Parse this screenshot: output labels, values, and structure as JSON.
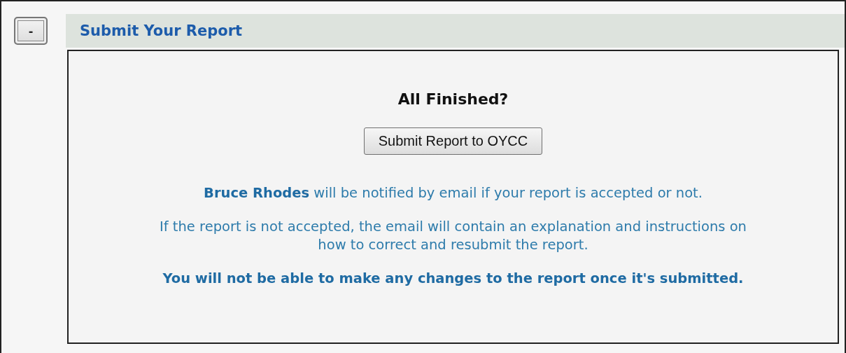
{
  "collapse_button": {
    "label": "-",
    "expanded": true
  },
  "section": {
    "title": "Submit Your Report",
    "heading": "All Finished?",
    "submit_button": "Submit Report to OYCC",
    "notice": "**Bruce Rhodes** will be notified by email if your report is accepted or not.",
    "explanation": "If the report is not accepted, the email will contain an explanation and instructions on how to correct and resubmit the report.",
    "warning": "You will not be able to make any changes to the report once it's submitted."
  }
}
